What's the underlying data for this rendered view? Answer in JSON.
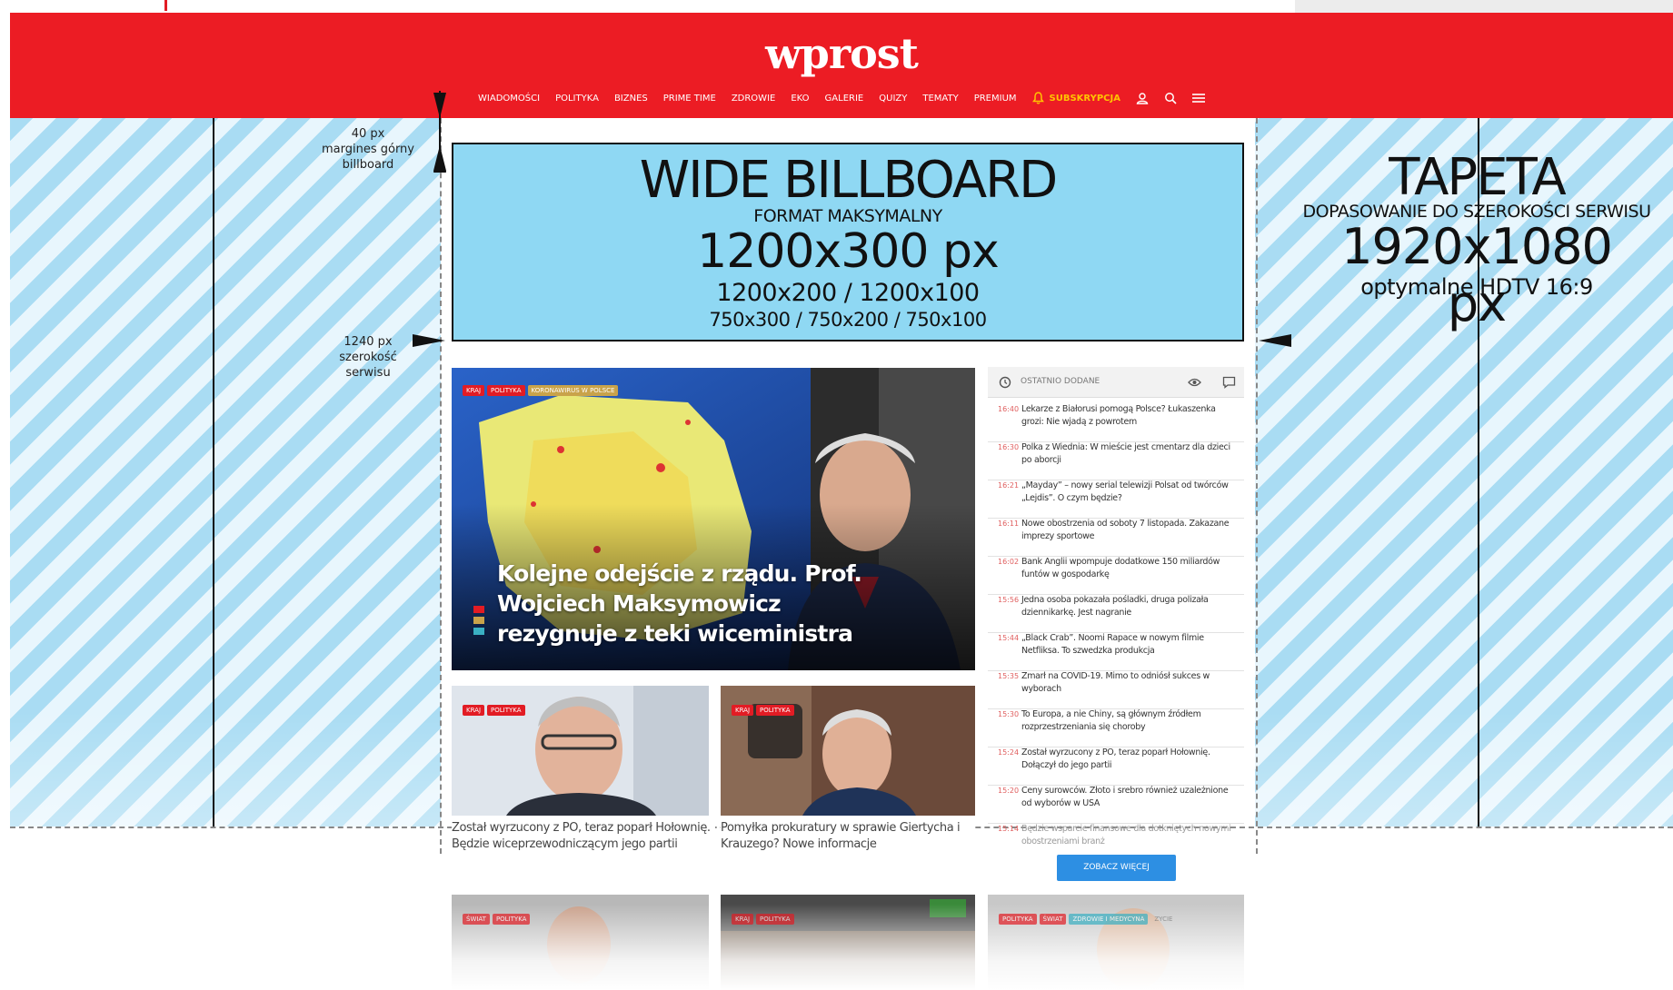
{
  "header": {
    "logo": "wprost",
    "nav": [
      "WIADOMOŚCI",
      "POLITYKA",
      "BIZNES",
      "PRIME TIME",
      "ZDROWIE",
      "EKO",
      "GALERIE",
      "QUIZY",
      "TEMATY",
      "PREMIUM"
    ],
    "subscribe": "SUBSKRYPCJA",
    "icons": [
      "bell-icon",
      "user-icon",
      "search-icon",
      "menu-icon"
    ]
  },
  "annotations": {
    "top_margin": [
      "40 px",
      "margines górny",
      "billboard"
    ],
    "site_width": [
      "1240 px",
      "szerokość",
      "serwisu"
    ]
  },
  "billboard": {
    "title": "WIDE BILLBOARD",
    "subtitle": "FORMAT MAKSYMALNY",
    "size": "1200x300 px",
    "alt_sizes_1": "1200x200 / 1200x100",
    "alt_sizes_2": "750x300 / 750x200 / 750x100"
  },
  "wallpaper": {
    "title": "TAPETA",
    "subtitle": "DOPASOWANIE DO SZEROKOŚCI SERWISU",
    "size": "1920x1080 px",
    "note": "optymalne HDTV 16:9"
  },
  "main_article": {
    "tags": [
      "KRAJ",
      "POLITYKA",
      "KORONAWIRUS W POLSCE"
    ],
    "title": "Kolejne odejście z rządu. Prof. Wojciech Maksymowicz rezygnuje z teki wiceministra"
  },
  "articles": [
    {
      "tags": [
        "KRAJ",
        "POLITYKA"
      ],
      "title": "Został wyrzucony z PO, teraz poparł Hołownię. Będzie wiceprzewodniczącym jego partii"
    },
    {
      "tags": [
        "KRAJ",
        "POLITYKA"
      ],
      "title": "Pomyłka prokuratury w sprawie Giertycha i Krauzego? Nowe informacje"
    }
  ],
  "sidebar": {
    "heading": "OSTATNIO DODANE",
    "items": [
      {
        "time": "16:40",
        "text": "Lekarze z Białorusi pomogą Polsce? Łukaszenka grozi: Nie wjadą z powrotem"
      },
      {
        "time": "16:30",
        "text": "Polka z Wiednia: W mieście jest cmentarz dla dzieci po aborcji"
      },
      {
        "time": "16:21",
        "text": "„Mayday” – nowy serial telewizji Polsat od twórców „Lejdis”. O czym będzie?"
      },
      {
        "time": "16:11",
        "text": "Nowe obostrzenia od soboty 7 listopada. Zakazane imprezy sportowe"
      },
      {
        "time": "16:02",
        "text": "Bank Anglii wpompuje dodatkowe 150 miliardów funtów w gospodarkę"
      },
      {
        "time": "15:56",
        "text": "Jedna osoba pokazała pośladki, druga polizała dziennikarkę. Jest nagranie"
      },
      {
        "time": "15:44",
        "text": "„Black Crab”. Noomi Rapace w nowym filmie Netfliksa. To szwedzka produkcja"
      },
      {
        "time": "15:35",
        "text": "Zmarł na COVID-19. Mimo to odniósł sukces w wyborach"
      },
      {
        "time": "15:30",
        "text": "To Europa, a nie Chiny, są głównym źródłem rozprzestrzeniania się choroby"
      },
      {
        "time": "15:24",
        "text": "Został wyrzucony z PO, teraz poparł Hołownię. Dołączył do jego partii"
      },
      {
        "time": "15:20",
        "text": "Ceny surowców. Złoto i srebro również uzależnione od wyborów w USA"
      },
      {
        "time": "15:14",
        "text": "Będzie wsparcie finansowe dla dotkniętych nowymi obostrzeniami branż"
      }
    ],
    "more_button": "ZOBACZ WIĘCEJ"
  },
  "bottom_cards": [
    {
      "tags": [
        "ŚWIAT",
        "POLITYKA"
      ]
    },
    {
      "tags": [
        "KRAJ",
        "POLITYKA"
      ]
    },
    {
      "tags": [
        "POLITYKA",
        "ŚWIAT",
        "ZDROWIE I MEDYCYNA",
        "ZYCIE"
      ]
    }
  ]
}
